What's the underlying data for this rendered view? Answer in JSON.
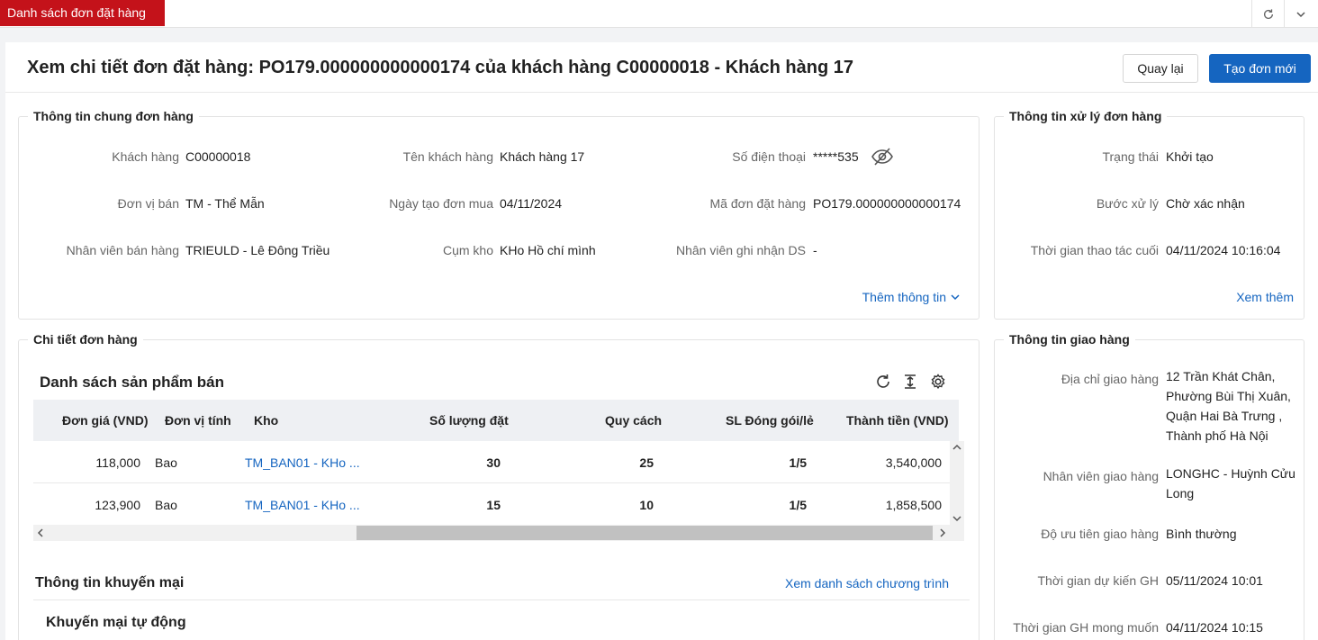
{
  "tabbar": {
    "active_tab": "Danh sách đơn đặt hàng"
  },
  "header": {
    "title": "Xem chi tiết đơn đặt hàng: PO179.000000000000174 của khách hàng C00000018 - Khách hàng 17",
    "back_label": "Quay lại",
    "new_label": "Tạo đơn mới"
  },
  "general": {
    "title": "Thông tin chung đơn hàng",
    "fields": [
      {
        "label": "Khách hàng",
        "value": "C00000018"
      },
      {
        "label": "Tên khách hàng",
        "value": "Khách hàng 17"
      },
      {
        "label": "Số điện thoại",
        "value": "*****535"
      },
      {
        "label": "Đơn vị bán",
        "value": "TM - Thể Mẫn"
      },
      {
        "label": "Ngày tạo đơn mua",
        "value": "04/11/2024"
      },
      {
        "label": "Mã đơn đặt hàng",
        "value": "PO179.000000000000174"
      },
      {
        "label": "Nhân viên bán hàng",
        "value": "TRIEULD - Lê Đông Triều"
      },
      {
        "label": "Cụm kho",
        "value": "KHo Hồ chí mình"
      },
      {
        "label": "Nhân viên ghi nhận DS",
        "value": "-"
      }
    ],
    "more_label": "Thêm thông tin"
  },
  "processing": {
    "title": "Thông tin xử lý đơn hàng",
    "fields": [
      {
        "label": "Trạng thái",
        "value": "Khởi tạo"
      },
      {
        "label": "Bước xử lý",
        "value": "Chờ xác nhận"
      },
      {
        "label": "Thời gian thao tác cuối",
        "value": "04/11/2024 10:16:04"
      }
    ],
    "more_label": "Xem thêm"
  },
  "details": {
    "title": "Chi tiết đơn hàng",
    "list_title": "Danh sách sản phẩm bán",
    "columns": [
      "Đơn giá (VND)",
      "Đơn vị tính",
      "Kho",
      "Số lượng đặt",
      "Quy cách",
      "SL Đóng gói/lẻ",
      "Thành tiền (VND)"
    ],
    "rows": [
      {
        "price": "118,000",
        "unit": "Bao",
        "warehouse": "TM_BAN01 - KHo ...",
        "qty": "30",
        "spec": "25",
        "pack": "1/5",
        "total": "3,540,000"
      },
      {
        "price": "123,900",
        "unit": "Bao",
        "warehouse": "TM_BAN01 - KHo ...",
        "qty": "15",
        "spec": "10",
        "pack": "1/5",
        "total": "1,858,500"
      }
    ],
    "promo_title": "Thông tin khuyến mại",
    "promo_link": "Xem danh sách chương trình",
    "auto_promo_title": "Khuyến mại tự động"
  },
  "delivery": {
    "title": "Thông tin giao hàng",
    "address_label": "Địa chỉ giao hàng",
    "address_lines": [
      "12 Trần Khát Chân,",
      "Phường Bùi Thị Xuân,",
      "Quận Hai Bà Trưng ,",
      "Thành phố Hà Nội"
    ],
    "staff_label": "Nhân viên giao hàng",
    "staff_lines": [
      "LONGHC - Huỳnh Cửu",
      "Long"
    ],
    "fields": [
      {
        "label": "Độ ưu tiên giao hàng",
        "value": "Bình thường"
      },
      {
        "label": "Thời gian dự kiến GH",
        "value": "05/11/2024 10:01"
      },
      {
        "label": "Thời gian GH mong muốn",
        "value": "04/11/2024 10:15"
      }
    ]
  },
  "icons": [
    "refresh-icon",
    "chevron-down-icon",
    "eye-off-icon",
    "reload-icon",
    "column-height-icon",
    "settings-icon"
  ],
  "colors": {
    "brand_red": "#c4121a",
    "primary_blue": "#1565c0"
  }
}
